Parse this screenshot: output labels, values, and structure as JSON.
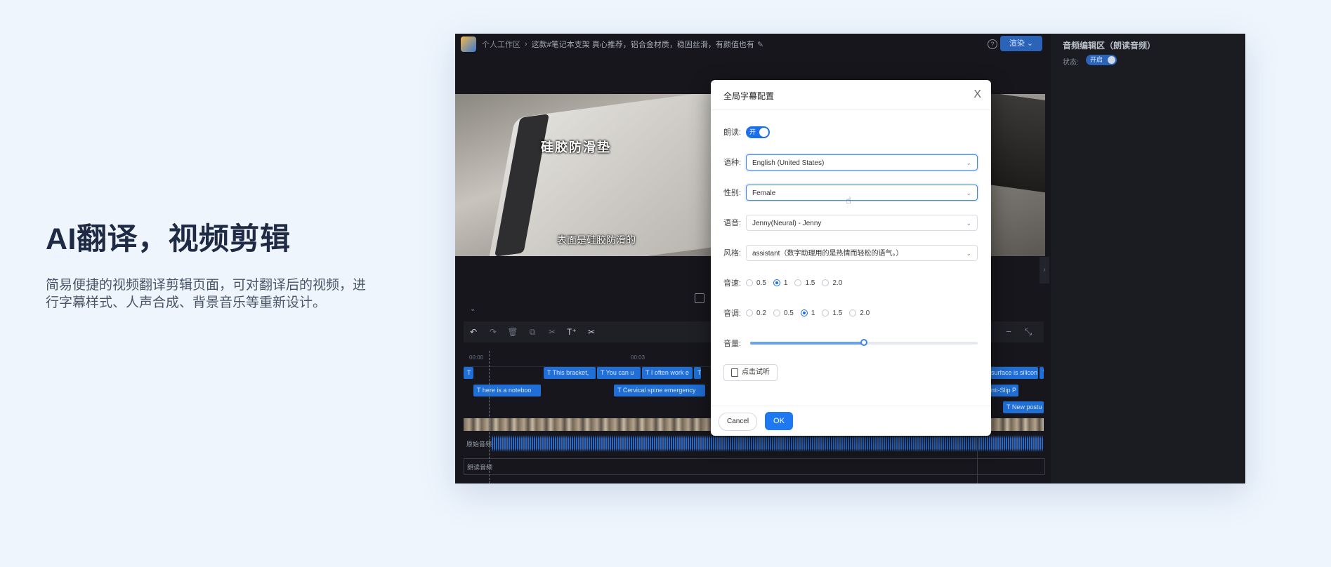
{
  "hero": {
    "title": "AI翻译，视频剪辑",
    "desc_line1": "简易便捷的视频翻译剪辑页面，可对翻译后的视频，进",
    "desc_line2": "行字幕样式、人声合成、背景音乐等重新设计。"
  },
  "topbar": {
    "breadcrumb": "个人工作区",
    "title": "这款#笔记本支架 真心推荐，铝合金材质，稳固丝滑，有颜值也有",
    "render_label": "渲染 ⌄"
  },
  "right_panel": {
    "title": "音频编辑区（朗读音频）",
    "status_label": "状态:",
    "status_value": "开启"
  },
  "video": {
    "overlay_text": "硅胶防滑垫",
    "subtitle": "表面是硅胶防滑的"
  },
  "timeline": {
    "ticks": [
      "00:00",
      "00:03"
    ],
    "track1": [
      "T",
      "T This bracket,",
      "T You can u",
      "T I often work e",
      "T",
      "surface is silicon",
      "T"
    ],
    "track2": [
      "T here is a noteboo",
      "T Cervical spine emergency",
      "nti-Slip P"
    ],
    "track3": [
      "T New postu"
    ],
    "audio_label": "原始音频",
    "read_label": "朗读音频"
  },
  "modal": {
    "title": "全局字幕配置",
    "close": "X",
    "read_label": "朗读:",
    "read_toggle": "开",
    "language_label": "语种:",
    "language_value": "English (United States)",
    "gender_label": "性别:",
    "gender_value": "Female",
    "voice_label": "语音:",
    "voice_value": "Jenny(Neural) - Jenny",
    "style_label": "风格:",
    "style_value": "assistant（数字助理用的是热情而轻松的语气。）",
    "speed_label": "音速:",
    "speed_options": [
      "0.5",
      "1",
      "1.5",
      "2.0"
    ],
    "speed_selected": "1",
    "pitch_label": "音调:",
    "pitch_options": [
      "0.2",
      "0.5",
      "1",
      "1.5",
      "2.0"
    ],
    "pitch_selected": "1",
    "volume_label": "音量:",
    "volume_level": 0.5,
    "listen_button": "点击试听",
    "cancel": "Cancel",
    "ok": "OK"
  },
  "colors": {
    "accent": "#1d6fe8",
    "page_bg": "#eef5fd",
    "app_bg": "#16161c"
  }
}
